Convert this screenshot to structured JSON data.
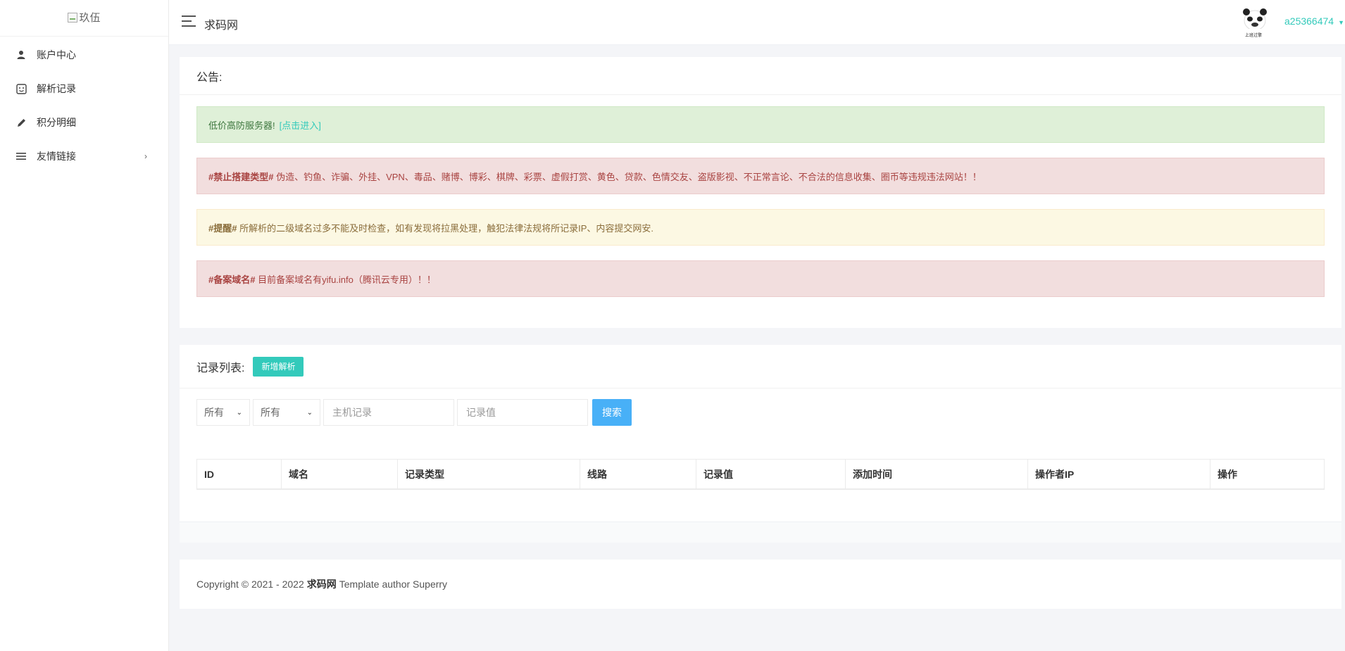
{
  "sidebar": {
    "logo_alt": "玖伍",
    "items": [
      {
        "label": "账户中心",
        "icon": "user-icon"
      },
      {
        "label": "解析记录",
        "icon": "record-icon"
      },
      {
        "label": "积分明细",
        "icon": "pencil-icon"
      },
      {
        "label": "友情链接",
        "icon": "menu-icon",
        "has_submenu": true
      }
    ]
  },
  "topbar": {
    "title": "求码网",
    "username": "a25366474",
    "avatar_caption": "上班过擎"
  },
  "notice": {
    "heading": "公告:",
    "alerts": [
      {
        "type": "success",
        "bold": "",
        "text": "低价高防服务器!",
        "link": "[点击进入]"
      },
      {
        "type": "danger",
        "bold": "#禁止搭建类型#",
        "text": " 伪造、钓鱼、诈骗、外挂、VPN、毒品、赌博、博彩、棋牌、彩票、虚假打赏、黄色、贷款、色情交友、盗版影视、不正常言论、不合法的信息收集、圈币等违规违法网站！！"
      },
      {
        "type": "warning",
        "bold": "#提醒#",
        "text": " 所解析的二级域名过多不能及时检查，如有发现将拉黑处理，触犯法律法规将所记录IP、内容提交网安."
      },
      {
        "type": "danger",
        "bold": "#备案域名#",
        "text": " 目前备案域名有yifu.info（腾讯云专用）！！"
      }
    ]
  },
  "records": {
    "heading": "记录列表:",
    "add_button": "新增解析",
    "filter1": "所有",
    "filter2": "所有",
    "host_placeholder": "主机记录",
    "value_placeholder": "记录值",
    "search_button": "搜索",
    "columns": [
      "ID",
      "域名",
      "记录类型",
      "线路",
      "记录值",
      "添加时间",
      "操作者IP",
      "操作"
    ]
  },
  "footer": {
    "prefix": "Copyright © 2021 - 2022",
    "brand": "求码网",
    "suffix": "Template author Superry"
  },
  "colors": {
    "accent": "#33cabb",
    "search": "#48b0f7"
  }
}
